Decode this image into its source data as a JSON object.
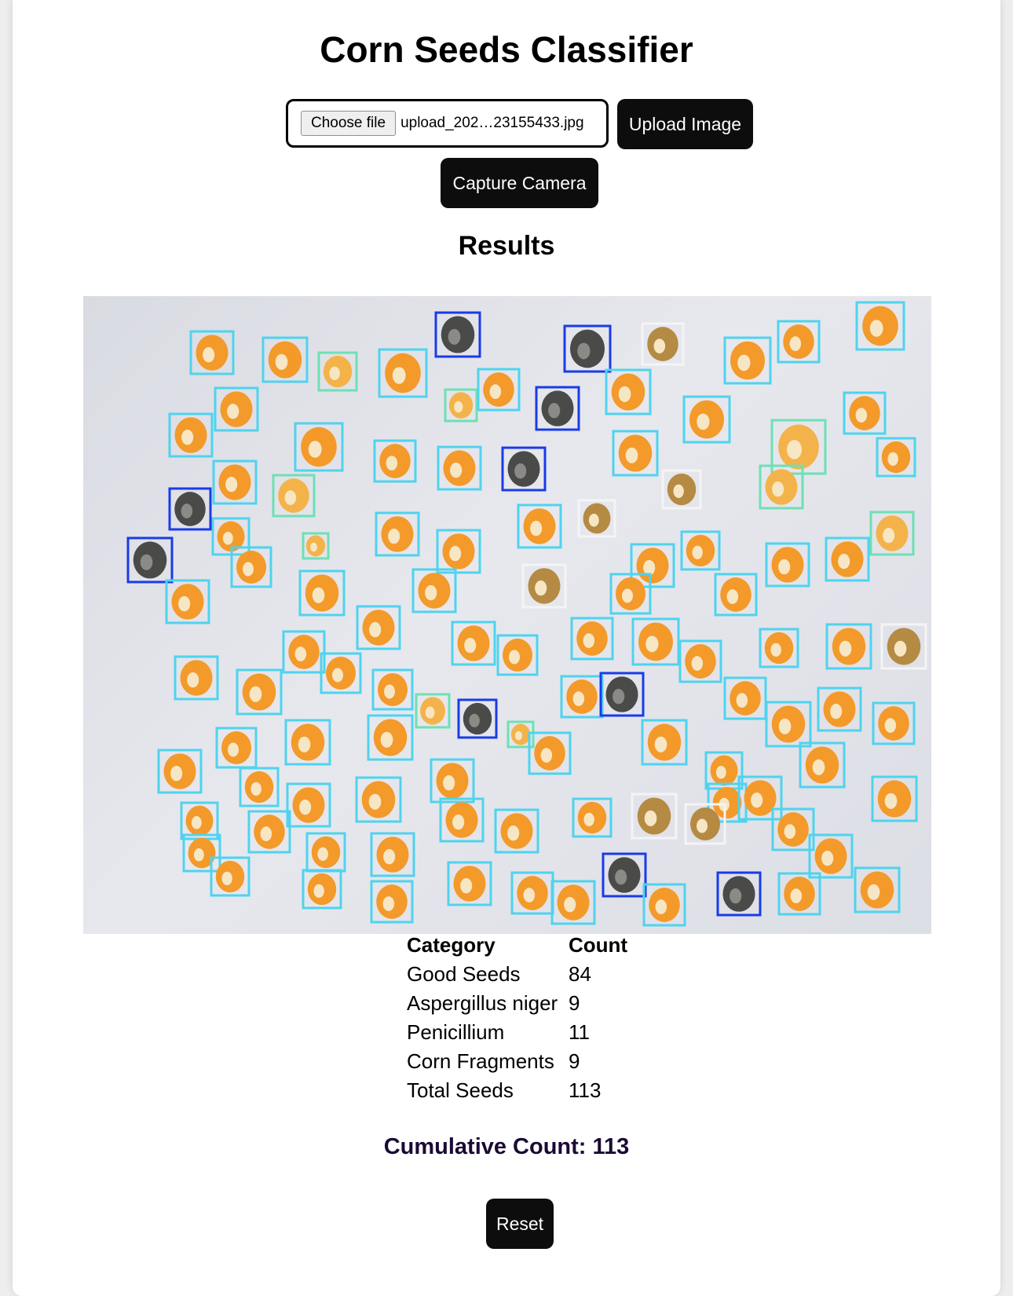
{
  "page": {
    "title": "Corn Seeds Classifier"
  },
  "upload": {
    "choose_file_label": "Choose file",
    "file_name": "upload_202…23155433.jpg",
    "upload_button": "Upload Image",
    "capture_button": "Capture Camera"
  },
  "results": {
    "heading": "Results",
    "table": {
      "headers": [
        "Category",
        "Count"
      ],
      "rows": [
        {
          "category": "Good Seeds",
          "count": "84"
        },
        {
          "category": "Aspergillus niger",
          "count": "9"
        },
        {
          "category": "Penicillium",
          "count": "11"
        },
        {
          "category": "Corn Fragments",
          "count": "9"
        },
        {
          "category": "Total Seeds",
          "count": "113"
        }
      ]
    },
    "cumulative_label": "Cumulative Count: 113",
    "reset_button": "Reset"
  },
  "detection_legend_colors": {
    "good_seeds": "#4fd3ee",
    "aspergillus_niger": "#1a3be8",
    "penicillium": "#f4f4f4",
    "corn_fragments": "#6ee0b4"
  }
}
